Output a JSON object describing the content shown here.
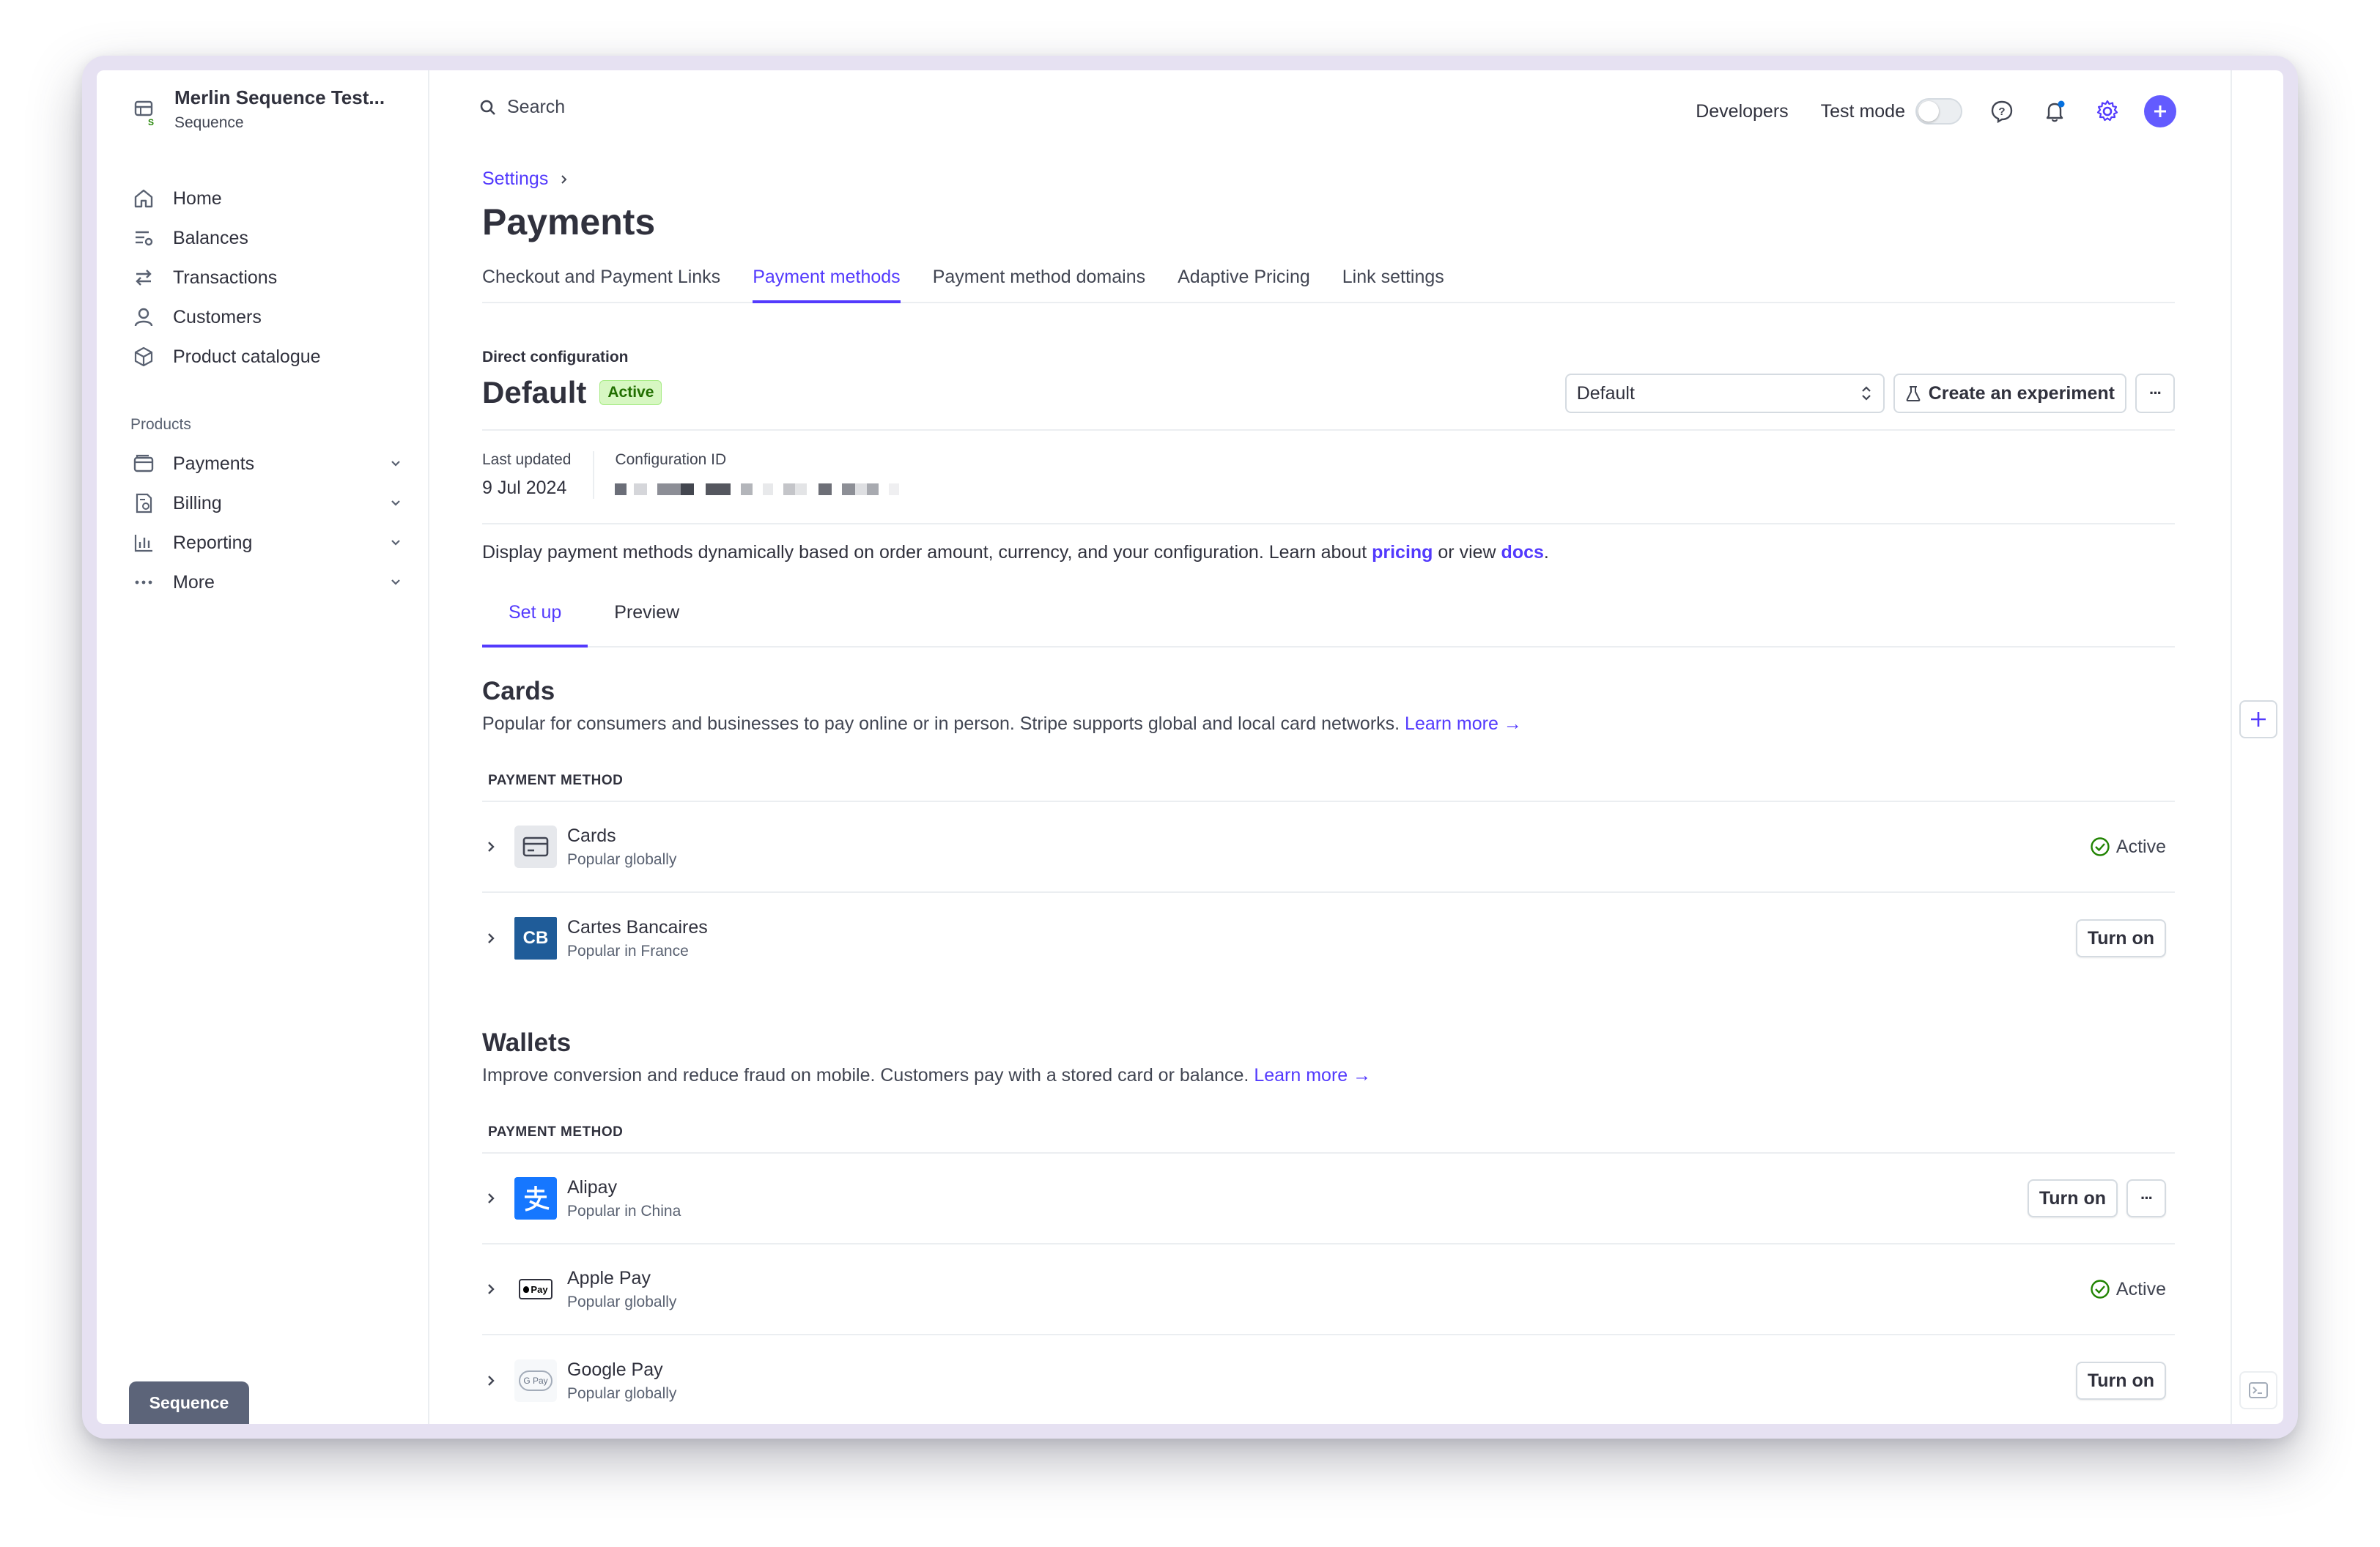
{
  "account": {
    "name": "Merlin Sequence Test...",
    "sub": "Sequence"
  },
  "nav": {
    "items": [
      {
        "label": "Home",
        "icon": "home-icon"
      },
      {
        "label": "Balances",
        "icon": "balances-icon"
      },
      {
        "label": "Transactions",
        "icon": "transactions-icon"
      },
      {
        "label": "Customers",
        "icon": "customers-icon"
      },
      {
        "label": "Product catalogue",
        "icon": "product-catalogue-icon"
      }
    ],
    "section_label": "Products",
    "products": [
      {
        "label": "Payments",
        "icon": "payments-icon"
      },
      {
        "label": "Billing",
        "icon": "billing-icon"
      },
      {
        "label": "Reporting",
        "icon": "reporting-icon"
      },
      {
        "label": "More",
        "icon": "more-icon"
      }
    ]
  },
  "sandbox_badge": "Sequence",
  "topbar": {
    "search_placeholder": "Search",
    "developers": "Developers",
    "test_mode": "Test mode"
  },
  "breadcrumb": "Settings",
  "page_title": "Payments",
  "tabs": [
    {
      "label": "Checkout and Payment Links",
      "active": false
    },
    {
      "label": "Payment methods",
      "active": true
    },
    {
      "label": "Payment method domains",
      "active": false
    },
    {
      "label": "Adaptive Pricing",
      "active": false
    },
    {
      "label": "Link settings",
      "active": false
    }
  ],
  "config": {
    "label": "Direct configuration",
    "title": "Default",
    "status": "Active",
    "select_value": "Default",
    "experiment_btn": "Create an experiment",
    "more_btn": "···",
    "last_updated_label": "Last updated",
    "last_updated_value": "9 Jul 2024",
    "config_id_label": "Configuration ID"
  },
  "description": {
    "text1": "Display payment methods dynamically based on order amount, currency, and your configuration. Learn about ",
    "link1": "pricing",
    "text2": " or view ",
    "link2": "docs",
    "text3": "."
  },
  "subtabs": [
    {
      "label": "Set up",
      "active": true
    },
    {
      "label": "Preview",
      "active": false
    }
  ],
  "sections": {
    "cards": {
      "title": "Cards",
      "desc": "Popular for consumers and businesses to pay online or in person. Stripe supports global and local card networks.",
      "learn_more": "Learn more →",
      "header": "PAYMENT METHOD",
      "rows": [
        {
          "name": "Cards",
          "sub": "Popular globally",
          "status": "Active"
        },
        {
          "name": "Cartes Bancaires",
          "sub": "Popular in France",
          "action": "Turn on"
        }
      ]
    },
    "wallets": {
      "title": "Wallets",
      "desc": "Improve conversion and reduce fraud on mobile. Customers pay with a stored card or balance.",
      "learn_more": "Learn more →",
      "header": "PAYMENT METHOD",
      "rows": [
        {
          "name": "Alipay",
          "sub": "Popular in China",
          "action": "Turn on",
          "more": "···"
        },
        {
          "name": "Apple Pay",
          "sub": "Popular globally",
          "status": "Active"
        },
        {
          "name": "Google Pay",
          "sub": "Popular globally",
          "action": "Turn on"
        }
      ]
    }
  },
  "logo_text": {
    "cb": "CB",
    "apple_pay": "Pay",
    "google_pay": "G Pay"
  },
  "colors": {
    "accent": "#533afd",
    "active_green": "#228403",
    "cb_blue": "#1f5c99",
    "alipay_blue": "#1677ff"
  }
}
